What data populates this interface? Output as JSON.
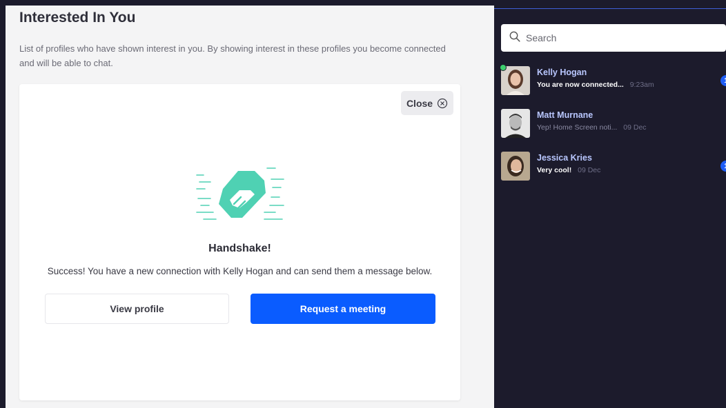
{
  "page": {
    "title": "Interested In You",
    "description": "List of profiles who have shown interest in you. By showing interest in these profiles you become connected and will be able to chat."
  },
  "modal": {
    "close_label": "Close",
    "icon": "handshake-icon",
    "title": "Handshake!",
    "message": "Success! You have a new connection with Kelly Hogan and can send them a message below.",
    "view_profile_label": "View profile",
    "request_meeting_label": "Request a meeting",
    "accent_color": "#4fd1b3",
    "primary_color": "#0a5cff"
  },
  "sidebar": {
    "search": {
      "placeholder": "Search",
      "value": ""
    },
    "conversations": [
      {
        "name": "Kelly Hogan",
        "preview": "You are now connected...",
        "time": "9:23am",
        "unread": "1",
        "online": true
      },
      {
        "name": "Matt Murnane",
        "preview": "Yep! Home Screen noti...",
        "time": "09 Dec",
        "unread": "",
        "online": false
      },
      {
        "name": "Jessica Kries",
        "preview": "Very cool!",
        "time": "09 Dec",
        "unread": "1",
        "online": false
      }
    ]
  }
}
